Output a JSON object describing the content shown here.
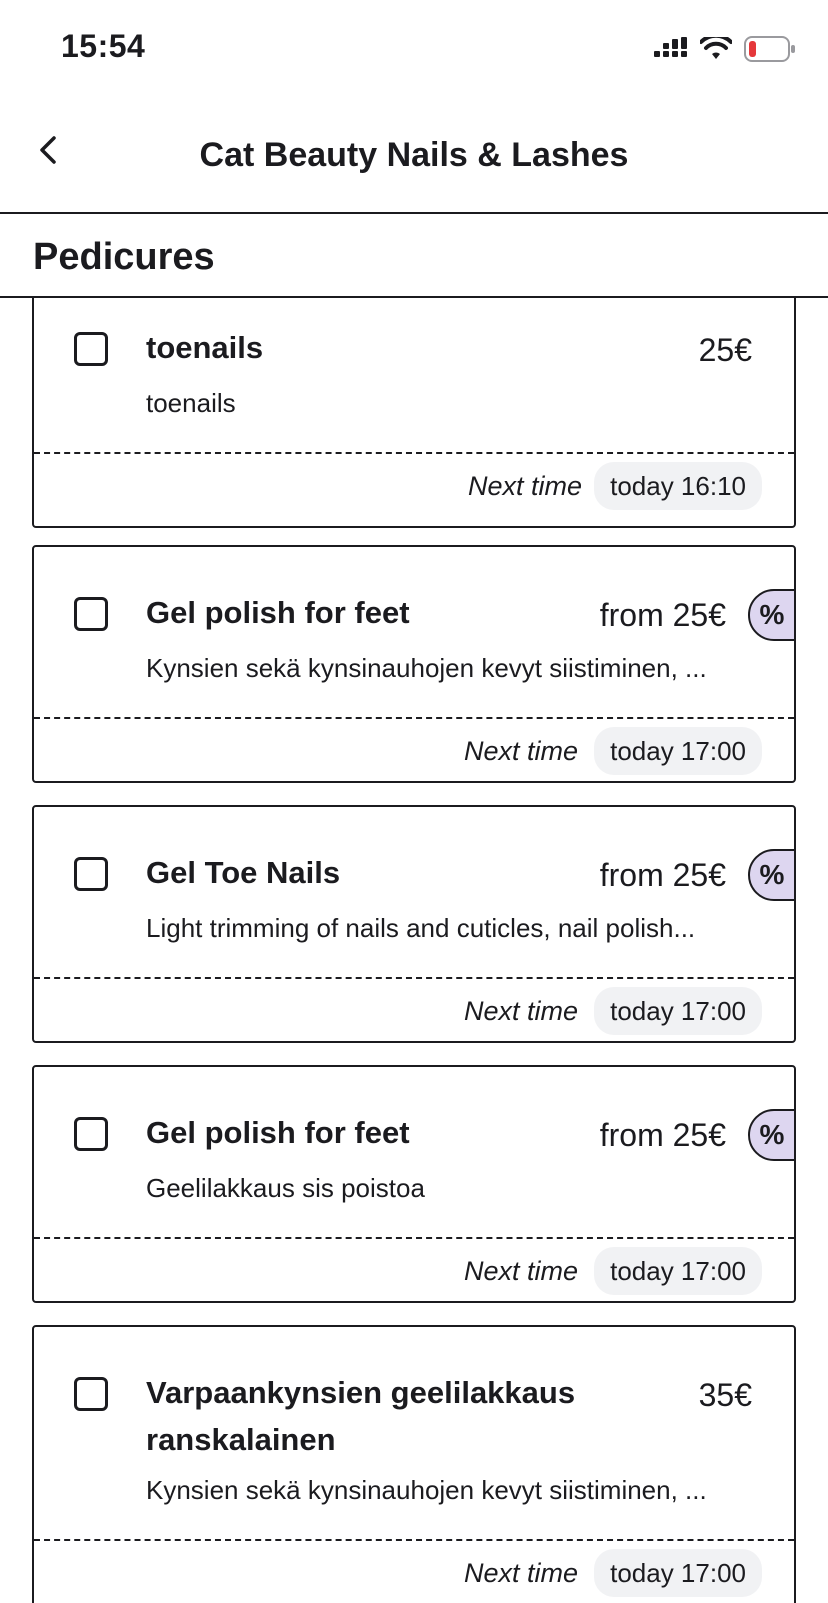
{
  "status_bar": {
    "time": "15:54",
    "icons": [
      "signal-icon",
      "wifi-icon",
      "battery-low-icon"
    ]
  },
  "header": {
    "back_icon": "chevron-left-icon",
    "title": "Cat Beauty Nails & Lashes"
  },
  "section": {
    "title": "Pedicures"
  },
  "colors": {
    "discount_tag": "#ddd6f0",
    "time_chip": "#f1f2f4",
    "battery_low": "#e5383b"
  },
  "services": [
    {
      "name": "toenails",
      "price": "25€",
      "description": "toenails",
      "discount": "",
      "next_label": "Next time",
      "next_time": "today 16:10"
    },
    {
      "name": "Gel polish for feet",
      "price": "from 25€",
      "description": "Kynsien sekä kynsinauhojen kevyt siistiminen, ...",
      "discount": "%",
      "next_label": "Next time",
      "next_time": "today 17:00"
    },
    {
      "name": "Gel Toe Nails",
      "price": "from 25€",
      "description": "Light trimming of nails and cuticles, nail polish...",
      "discount": "%",
      "next_label": "Next time",
      "next_time": "today 17:00"
    },
    {
      "name": "Gel polish for feet",
      "price": "from 25€",
      "description": "Geelilakkaus sis poistoa",
      "discount": "%",
      "next_label": "Next time",
      "next_time": "today 17:00"
    },
    {
      "name": "Varpaankynsien geelilakkaus ranskalainen",
      "price": "35€",
      "description": "Kynsien sekä kynsinauhojen kevyt siistiminen, ...",
      "discount": "",
      "next_label": "Next time",
      "next_time": "today 17:00"
    }
  ]
}
